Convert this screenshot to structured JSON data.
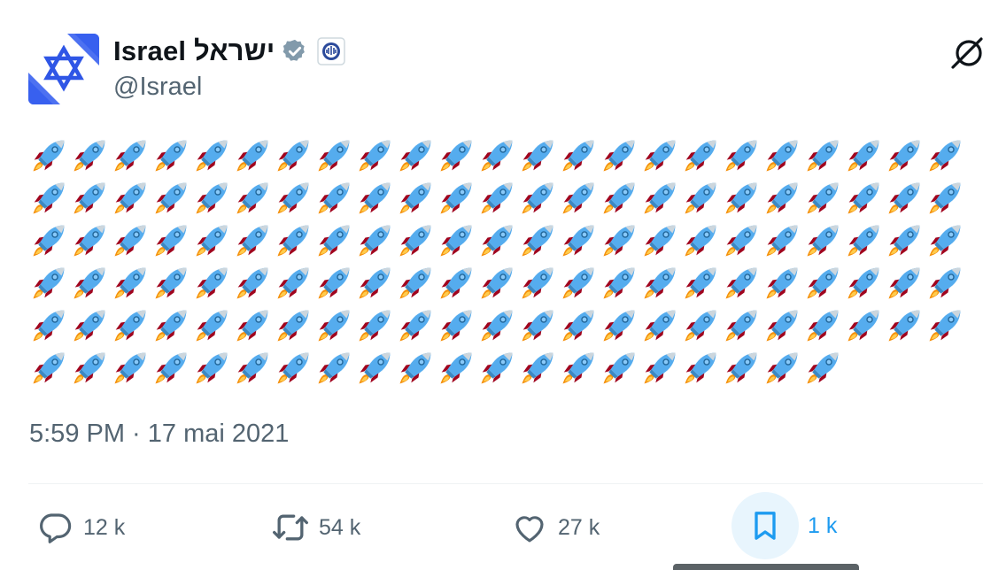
{
  "author": {
    "display_name": "Israel ישראל",
    "handle": "@Israel",
    "verified": true,
    "avatar_icon": "star-of-david-flag-icon",
    "affiliate_icon": "state-emblem-icon"
  },
  "tweet": {
    "body": {
      "emoji": "🚀",
      "emoji_name": "rocket",
      "rows": [
        23,
        23,
        23,
        23,
        23,
        20
      ]
    },
    "timestamp": "5:59 PM · 17 mai 2021"
  },
  "actions": [
    {
      "icon": "reply-icon",
      "count": "12 k"
    },
    {
      "icon": "retweet-icon",
      "count": "54 k"
    },
    {
      "icon": "like-icon",
      "count": "27 k"
    },
    {
      "icon": "bookmark-icon",
      "count": "1 k",
      "active": true
    }
  ],
  "colors": {
    "accent": "#1d9bf0",
    "muted": "#536471",
    "text": "#0f1419",
    "verified_badge": "#829aab"
  }
}
